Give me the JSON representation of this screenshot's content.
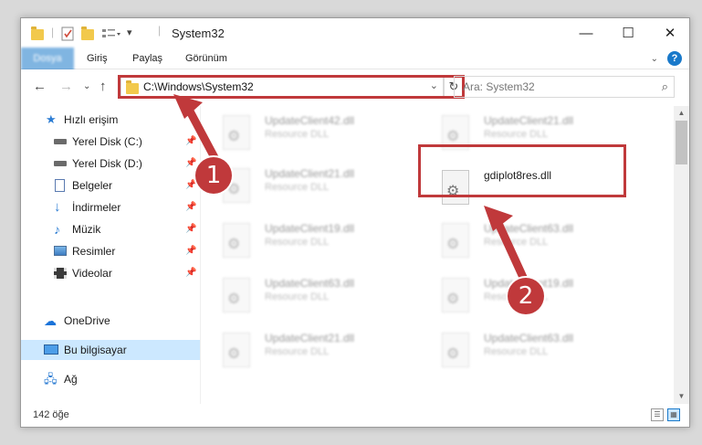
{
  "window": {
    "title": "System32",
    "controls": {
      "minimize": "—",
      "maximize": "☐",
      "close": "✕"
    }
  },
  "ribbon": {
    "tabs": [
      {
        "label": "Dosya",
        "active": true
      },
      {
        "label": "Giriş"
      },
      {
        "label": "Paylaş"
      },
      {
        "label": "Görünüm"
      }
    ],
    "help": "?"
  },
  "navigation": {
    "address": "C:\\Windows\\System32",
    "search_placeholder": "Ara: System32"
  },
  "sidebar": {
    "items": [
      {
        "label": "Hızlı erişim",
        "icon": "star-icon"
      },
      {
        "label": "Yerel Disk (C:)",
        "icon": "drive-icon",
        "pinned": true
      },
      {
        "label": "Yerel Disk (D:)",
        "icon": "drive-icon",
        "pinned": true
      },
      {
        "label": "Belgeler",
        "icon": "documents-icon",
        "pinned": true
      },
      {
        "label": "İndirmeler",
        "icon": "download-icon",
        "pinned": true
      },
      {
        "label": "Müzik",
        "icon": "music-icon",
        "pinned": true
      },
      {
        "label": "Resimler",
        "icon": "pictures-icon",
        "pinned": true
      },
      {
        "label": "Videolar",
        "icon": "videos-icon",
        "pinned": true
      },
      {
        "label": "OneDrive",
        "icon": "cloud-icon"
      },
      {
        "label": "Bu bilgisayar",
        "icon": "computer-icon",
        "selected": true
      },
      {
        "label": "Ağ",
        "icon": "network-icon"
      }
    ]
  },
  "files": [
    {
      "name": "UpdateClient42.dll",
      "type": "Resource DLL"
    },
    {
      "name": "UpdateClient21.dll",
      "type": "Resource DLL"
    },
    {
      "name": "UpdateClient21.dll",
      "type": "Resource DLL"
    },
    {
      "name": "gdiplot8res.dll",
      "type": "",
      "highlighted": true
    },
    {
      "name": "UpdateClient19.dll",
      "type": "Resource DLL"
    },
    {
      "name": "UpdateClient63.dll",
      "type": "Resource DLL"
    },
    {
      "name": "UpdateClient63.dll",
      "type": "Resource DLL"
    },
    {
      "name": "UpdateClient19.dll",
      "type": "Resource DLL"
    },
    {
      "name": "UpdateClient21.dll",
      "type": "Resource DLL"
    },
    {
      "name": "UpdateClient63.dll",
      "type": "Resource DLL"
    }
  ],
  "status": {
    "count": "142 öğe"
  },
  "annotations": {
    "step1": "1",
    "step2": "2",
    "color": "#c0393b"
  },
  "colors": {
    "accent": "#1979ca",
    "selection": "#cce8ff"
  }
}
